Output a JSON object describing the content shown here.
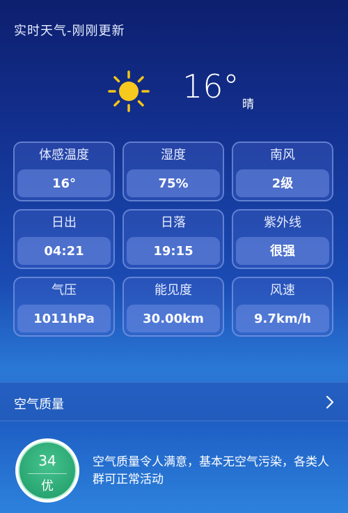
{
  "header": {
    "title": "实时天气-刚刚更新"
  },
  "current": {
    "temperature": "16°",
    "condition": "晴",
    "icon": "sun-icon"
  },
  "details": [
    {
      "label": "体感温度",
      "value": "16°"
    },
    {
      "label": "湿度",
      "value": "75%"
    },
    {
      "label": "南风",
      "value": "2级"
    },
    {
      "label": "日出",
      "value": "04:21"
    },
    {
      "label": "日落",
      "value": "19:15"
    },
    {
      "label": "紫外线",
      "value": "很强"
    },
    {
      "label": "气压",
      "value": "1011hPa"
    },
    {
      "label": "能见度",
      "value": "30.00km"
    },
    {
      "label": "风速",
      "value": "9.7km/h"
    }
  ],
  "air_quality": {
    "label": "空气质量",
    "aqi": "34",
    "level": "优",
    "description": "空气质量令人满意，基本无空气污染，各类人群可正常活动",
    "color": "#2aa673"
  }
}
